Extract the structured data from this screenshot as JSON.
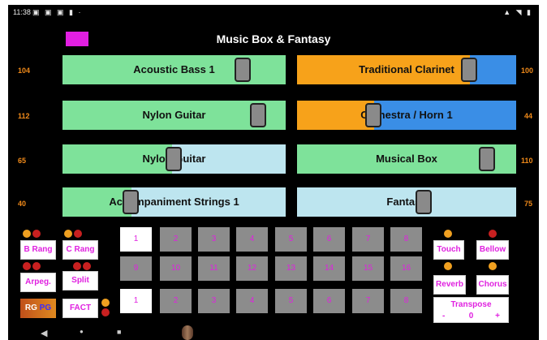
{
  "status": {
    "time": "11:38",
    "left_icons": "▣ ▣ ▣ ▮ ·",
    "right_icons": "▲ ◥ ▮"
  },
  "app": {
    "title": "Music Box & Fantasy"
  },
  "instruments": {
    "left": [
      {
        "label": "Acoustic Bass 1",
        "value": "104",
        "fill_pct": 100,
        "fill_color": "#7ee29a",
        "thumb_pct": 81
      },
      {
        "label": "Nylon Guitar",
        "value": "112",
        "fill_pct": 100,
        "fill_color": "#7ee29a",
        "thumb_pct": 88
      },
      {
        "label": "Nylon Guitar",
        "value": "65",
        "fill_pct": 49,
        "fill_color": "#7ee29a",
        "thumb_pct": 50
      },
      {
        "label": "Accompaniment Strings 1",
        "value": "40",
        "fill_pct": 31,
        "fill_color": "#7ee29a",
        "thumb_pct": 31
      }
    ],
    "right": [
      {
        "label": "Traditional Clarinet",
        "value": "100",
        "fill_pct": 79,
        "fill_color": "#f7a21a",
        "thumb_pct": 79,
        "bg": "#3a8ee6"
      },
      {
        "label": "Orchestra / Horn 1",
        "value": "44",
        "fill_pct": 35,
        "fill_color": "#f7a21a",
        "thumb_pct": 35,
        "bg": "#3a8ee6"
      },
      {
        "label": "Musical Box",
        "value": "110",
        "fill_pct": 100,
        "fill_color": "#7ee29a",
        "thumb_pct": 87,
        "bg": "#bde5ef"
      },
      {
        "label": "Fantasy",
        "value": "75",
        "fill_pct": 0,
        "fill_color": "#7ee29a",
        "thumb_pct": 58,
        "bg": "#bde5ef"
      }
    ]
  },
  "controls": {
    "b_rang": "B Rang",
    "c_rang": "C Rang",
    "arpeg": "Arpeg.",
    "split": "Split",
    "fact": "FACT",
    "rg": "RG",
    "pg": "PG",
    "touch": "Touch",
    "bellow": "Bellow",
    "reverb": "Reverb",
    "chorus": "Chorus",
    "transpose_label": "Transpose",
    "transpose_minus": "-",
    "transpose_value": "0",
    "transpose_plus": "+"
  },
  "keys": {
    "row1": [
      "1",
      "2",
      "3",
      "4",
      "5",
      "6",
      "7",
      "8"
    ],
    "row2": [
      "9",
      "10",
      "11",
      "12",
      "13",
      "14",
      "15",
      "16"
    ],
    "row3": [
      "1",
      "2",
      "3",
      "4",
      "5",
      "6",
      "7",
      "8"
    ],
    "row1_active": 0,
    "row3_active": 0
  },
  "nav": {
    "back": "◀",
    "home": "●",
    "recent": "■"
  }
}
